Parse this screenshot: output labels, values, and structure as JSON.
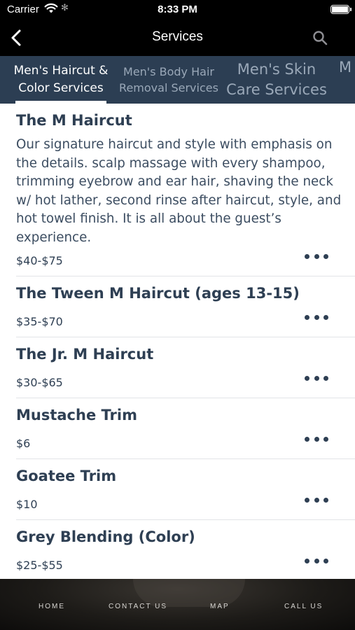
{
  "status_bar": {
    "carrier": "Carrier",
    "time": "8:33 PM"
  },
  "nav": {
    "title": "Services",
    "back_icon": "chevron-left-icon",
    "search_icon": "search-icon"
  },
  "tabs": [
    {
      "line1": "Men's Haircut &",
      "line2": "Color Services",
      "active": true
    },
    {
      "line1": "Men's Body Hair",
      "line2": "Removal Services",
      "active": false
    },
    {
      "line1": "Men's Skin",
      "line2": "Care Services",
      "active": false
    },
    {
      "line1": "M",
      "line2": "",
      "active": false
    }
  ],
  "services": [
    {
      "name": "The M Haircut",
      "description": "Our signature haircut and style with emphasis on the details. scalp massage with every shampoo, trimming eyebrow and ear hair, shaving the neck w/ hot lather, second rinse after haircut, style, and hot towel finish. It is all about the guest’s experience.",
      "price": "$40-$75"
    },
    {
      "name": "The Tween M Haircut (ages 13-15)",
      "description": "",
      "price": "$35-$70"
    },
    {
      "name": "The Jr. M Haircut",
      "description": "",
      "price": "$30-$65"
    },
    {
      "name": "Mustache Trim",
      "description": "",
      "price": "$6"
    },
    {
      "name": "Goatee Trim",
      "description": "",
      "price": "$10"
    },
    {
      "name": "Grey Blending (Color)",
      "description": "",
      "price": "$25-$55"
    }
  ],
  "footer": {
    "home": "HOME",
    "contact": "CONTACT US",
    "map": "MAP",
    "call": "CALL US"
  },
  "colors": {
    "tab_bar": "#2c3e53",
    "text_dark": "#2e3f53"
  }
}
